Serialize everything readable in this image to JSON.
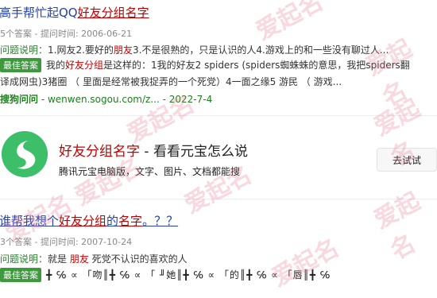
{
  "result1": {
    "title_prefix": "高手帮忙起QQ",
    "title_highlight": "好友分组名字",
    "meta": "5个答案 - 提问时间: 2006-06-21",
    "question_label": "问题说明：",
    "question_a": "1.网友2.要好的",
    "question_hl": "朋友",
    "question_b": "3.不是很熟的，只是认识的人4.游戏上的和一些没有聊过人...",
    "best_badge": "最佳答案",
    "answer_a": "我的",
    "answer_hl": "好友分组",
    "answer_b": "是这样的：1我的好友2 spiders (spiders蜘蛛蛛的意思，我把spiders翻",
    "answer_line2": "译成网虫)3猪圈 （ 里面是经常被我捉弄的一个死党）4一面之缘5 游民 （ 游戏...",
    "source_site": "搜狗问问",
    "source_rest": " - wenwen.sogou.com/z... - 2022-7-4"
  },
  "card": {
    "title_hl": "好友分组名字",
    "title_rest": " - 看看元宝怎么说",
    "subtitle": "腾讯元宝电脑版，文字、图片、文档都能搜",
    "button": "去试试"
  },
  "result2": {
    "title_a": "谁帮我想个",
    "title_hl1": "好友分组",
    "title_b": "的",
    "title_hl2": "名字",
    "title_c": "。？？",
    "meta": "3个答案 - 提问时间: 2007-10-24",
    "question_label": "问题说明：",
    "question_a": "就是 ",
    "question_hl": "朋友",
    "question_b": " 死党不认识的喜欢的人",
    "best_badge": "最佳答案",
    "garbled_answer": "╋ ℅ ∝ 「吻║╋ ℅ ∝ 「 ╜她║╋ ℅ ∝ 「的║╋ ℅ ∝ 「唇║╋ ℅"
  },
  "watermark": "爱起名"
}
